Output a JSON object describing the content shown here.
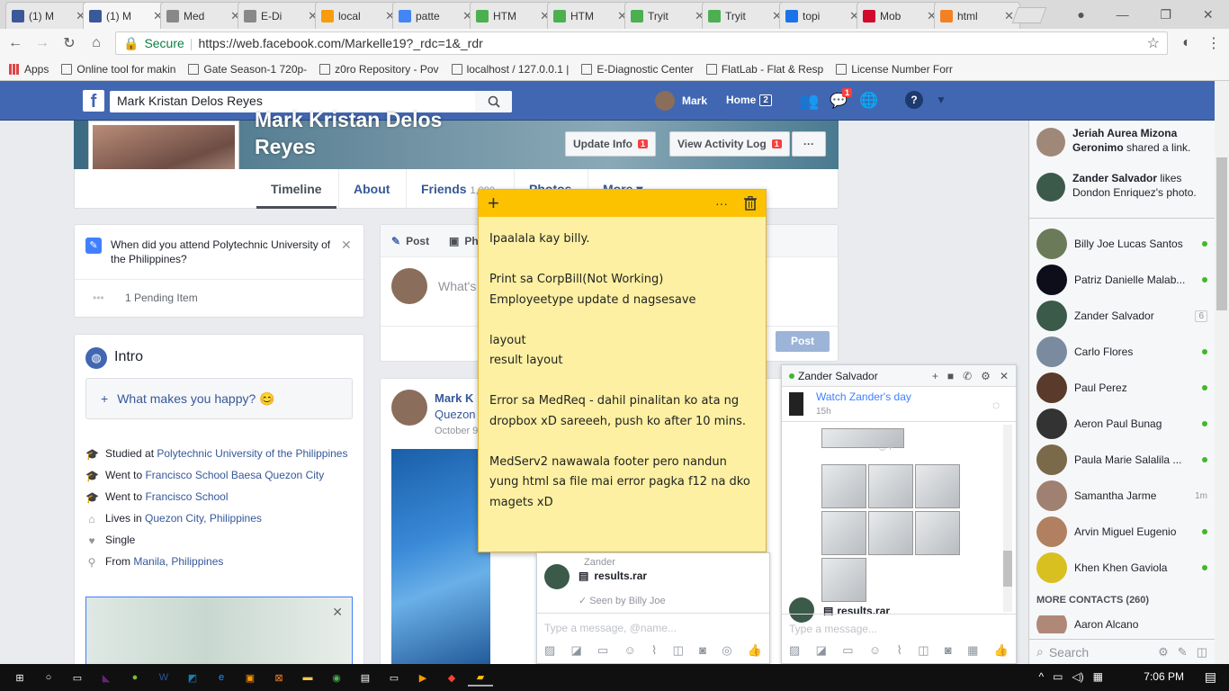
{
  "browser": {
    "tabs": [
      {
        "title": "(1) M",
        "icon": "facebook-icon",
        "color": "#3b5998"
      },
      {
        "title": "(1) M",
        "icon": "facebook-icon",
        "color": "#3b5998",
        "active": true
      },
      {
        "title": "Med",
        "icon": "page-icon",
        "color": "#888888"
      },
      {
        "title": "E-Di",
        "icon": "page-icon",
        "color": "#888888"
      },
      {
        "title": "local",
        "icon": "pma-icon",
        "color": "#f89c0e"
      },
      {
        "title": "patte",
        "icon": "google-icon",
        "color": "#4285f4"
      },
      {
        "title": "HTM",
        "icon": "w3-icon",
        "color": "#4caf50"
      },
      {
        "title": "HTM",
        "icon": "w3-icon",
        "color": "#4caf50"
      },
      {
        "title": "Tryit",
        "icon": "w3-icon",
        "color": "#4caf50"
      },
      {
        "title": "Tryit",
        "icon": "w3-icon",
        "color": "#4caf50"
      },
      {
        "title": "topi",
        "icon": "shield-icon",
        "color": "#1a73e8"
      },
      {
        "title": "Mob",
        "icon": "huawei-icon",
        "color": "#cf0a2c"
      },
      {
        "title": "html",
        "icon": "page-icon",
        "color": "#f48024"
      }
    ],
    "secure_label": "Secure",
    "url": "https://web.facebook.com/Markelle19?_rdc=1&_rdr",
    "bookmarks": [
      "Apps",
      "Online tool for makin",
      "Gate Season-1 720p-",
      "z0ro Repository - Pov",
      "localhost / 127.0.0.1 |",
      "E-Diagnostic Center",
      "FlatLab - Flat & Resp",
      "License Number Forr"
    ]
  },
  "fb": {
    "search_value": "Mark Kristan Delos Reyes",
    "user": "Mark",
    "home": "Home",
    "home_count": "2",
    "messages_count": "1",
    "profile_name": "Mark Kristan Delos Reyes",
    "update_info": "Update Info",
    "update_info_count": "1",
    "view_activity": "View Activity Log",
    "view_activity_count": "1",
    "more_dots": "···",
    "tabs": [
      "Timeline",
      "About",
      "Friends",
      "Photos",
      "More ▾"
    ],
    "friends_count": "1,000",
    "question": "When did you attend Polytechnic University of the Philippines?",
    "pending": "1 Pending Item",
    "intro_title": "Intro",
    "happy": "What makes you happy? 😊",
    "intro": [
      {
        "icon": "cap-icon",
        "pre": "Studied at ",
        "link": "Polytechnic University of the Philippines"
      },
      {
        "icon": "cap-icon",
        "pre": "Went to ",
        "link": "Francisco School Baesa Quezon City"
      },
      {
        "icon": "cap-icon",
        "pre": "Went to ",
        "link": "Francisco School"
      },
      {
        "icon": "home-icon",
        "pre": "Lives in ",
        "link": "Quezon City, Philippines"
      },
      {
        "icon": "heart-icon",
        "pre": "Single",
        "link": ""
      },
      {
        "icon": "pin-icon",
        "pre": "From ",
        "link": "Manila, Philippines"
      }
    ],
    "composer_post": "Post",
    "composer_photo": "Ph",
    "composer_placeholder": "What's",
    "post_button": "Post",
    "post_author": "Mark K",
    "post_sub": "Quezon",
    "post_date": "October 9"
  },
  "sticky": {
    "text": "Ipaalala kay billy.\n\nPrint sa CorpBill(Not Working)\nEmployeetype update d nagsesave\n\nlayout\nresult layout\n\nError sa MedReq - dahil pinalitan ko ata ng dropbox xD sareeeh, push ko after 10 mins.\n\nMedServ2 nawawala footer pero nandun yung html sa file mai error pagka f12 na dko magets xD"
  },
  "chat1": {
    "sender": "Zander",
    "file": "results.rar",
    "seen": "Seen by Billy Joe",
    "placeholder": "Type a message, @name..."
  },
  "chat2": {
    "title": "Zander Salvador",
    "watch": "Watch Zander's day",
    "time": "15h",
    "file": "results.rar",
    "placeholder": "Type a message..."
  },
  "sidebar": {
    "ticker": [
      {
        "name": "Jeriah Aurea Mizona Geronimo",
        "action": " shared a link."
      },
      {
        "name": "Zander Salvador",
        "action": " likes Dondon Enriquez's photo."
      }
    ],
    "contacts": [
      {
        "name": "Billy Joe Lucas Santos",
        "status": "online",
        "color": "#6b7b5a"
      },
      {
        "name": "Patriz Danielle Malab...",
        "status": "online",
        "color": "#0e0e1a"
      },
      {
        "name": "Zander Salvador",
        "status": "6",
        "color": "#3c5a4a"
      },
      {
        "name": "Carlo Flores",
        "status": "online",
        "color": "#7a8ba0"
      },
      {
        "name": "Paul Perez",
        "status": "online",
        "color": "#5a3a2a"
      },
      {
        "name": "Aeron Paul Bunag",
        "status": "online",
        "color": "#333333"
      },
      {
        "name": "Paula Marie Salalila ...",
        "status": "online",
        "color": "#7a6a4a"
      },
      {
        "name": "Samantha Jarme",
        "status": "1m",
        "color": "#a08070"
      },
      {
        "name": "Arvin Miguel Eugenio",
        "status": "online",
        "color": "#b08060"
      },
      {
        "name": "Khen Khen Gaviola",
        "status": "online",
        "color": "#d8c020"
      }
    ],
    "more_contacts": "MORE CONTACTS (260)",
    "last_contact": "Aaron Alcano",
    "search": "Search"
  },
  "taskbar": {
    "time": "7:06 PM"
  }
}
